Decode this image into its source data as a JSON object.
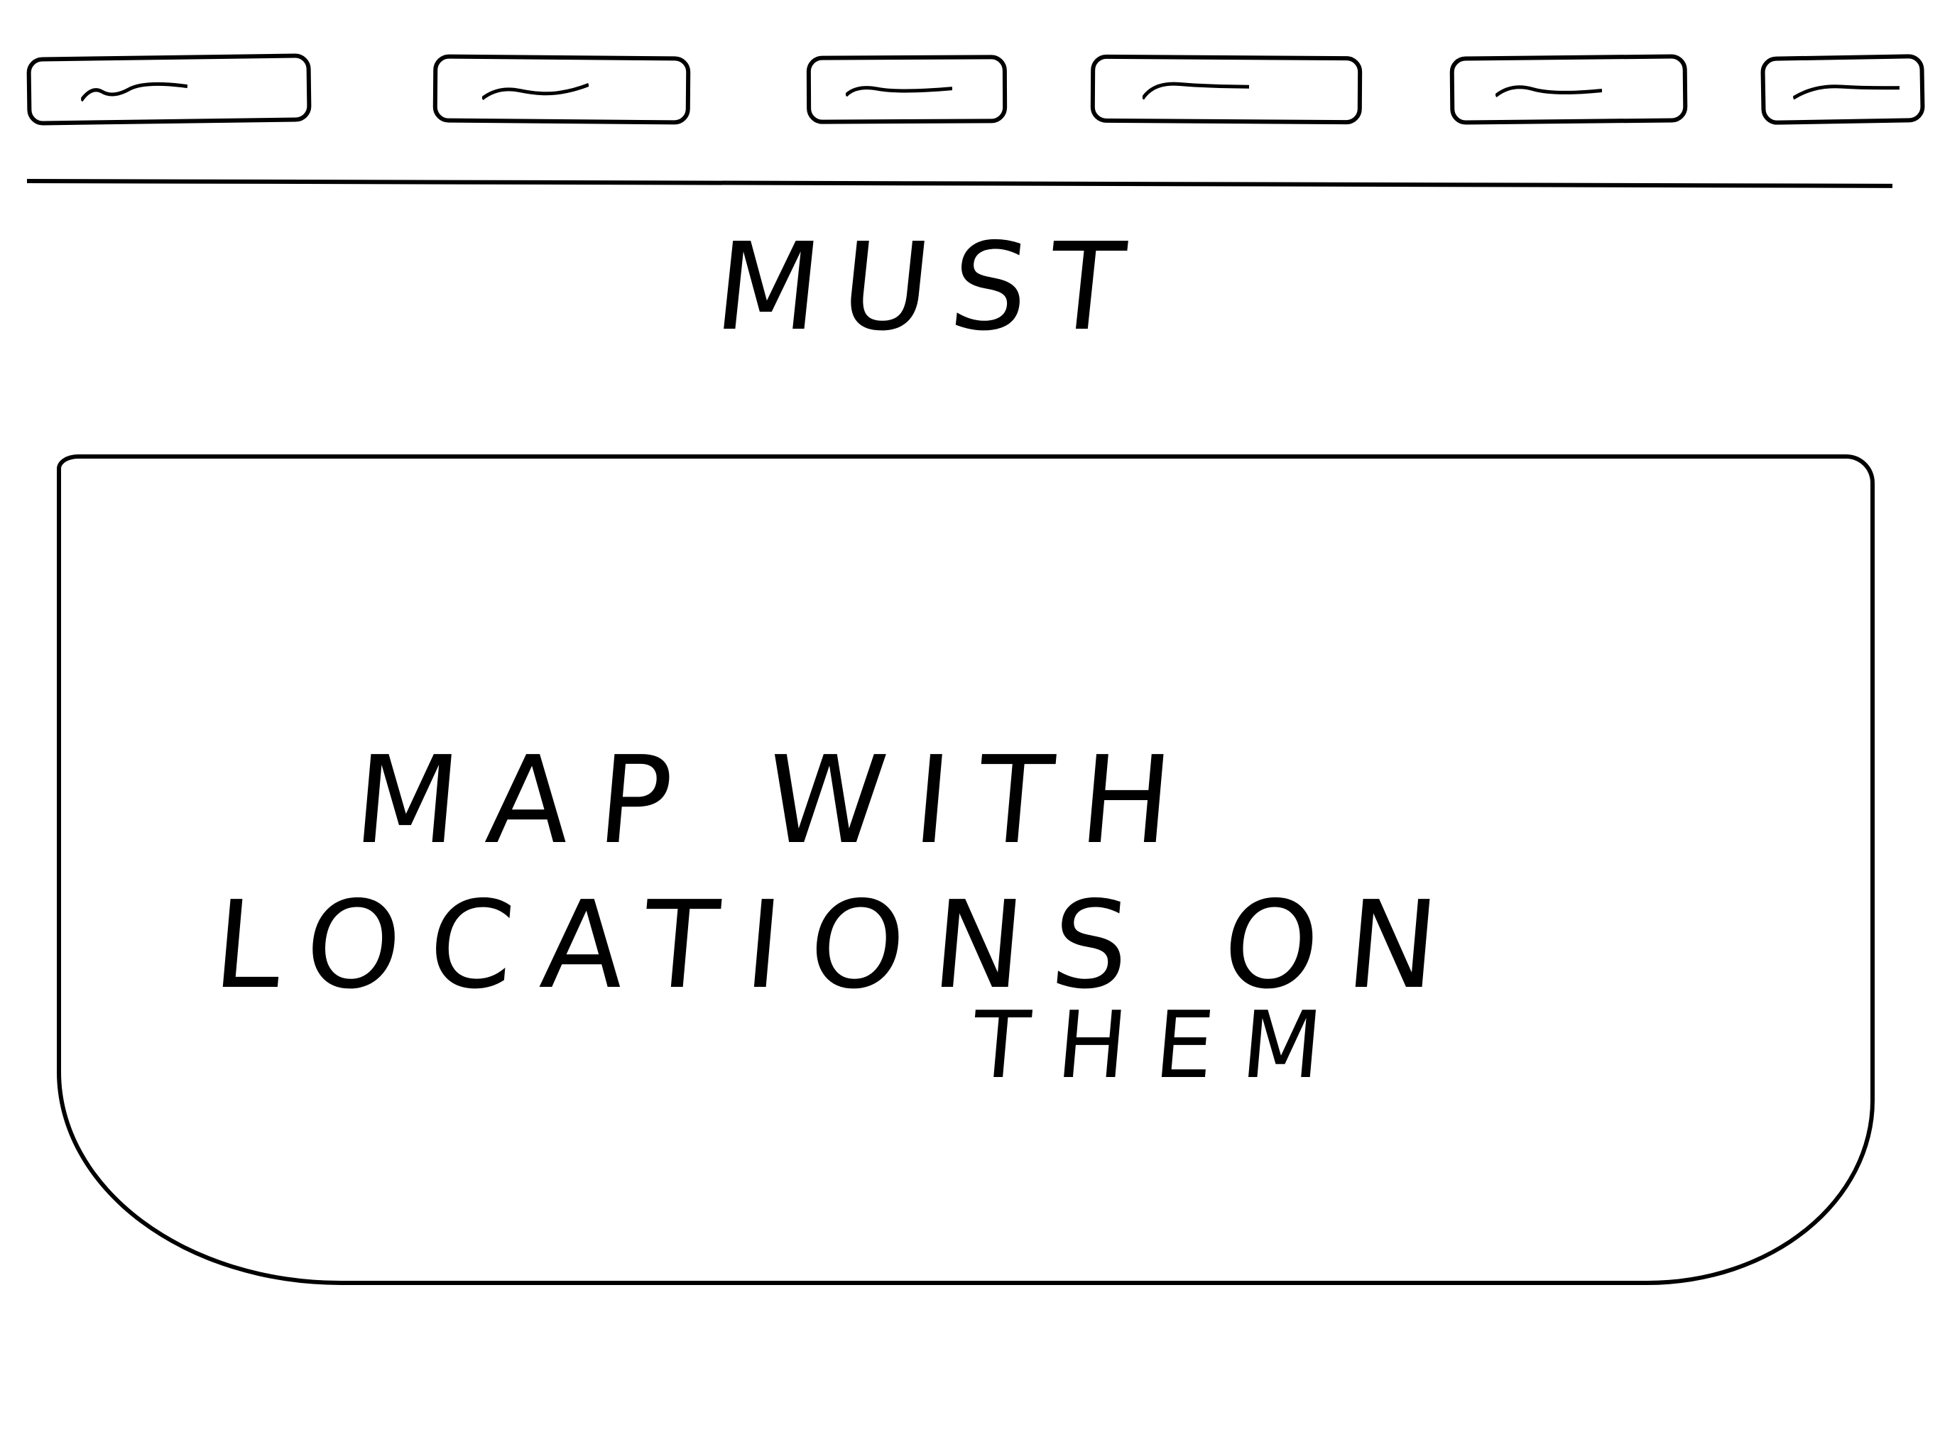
{
  "tabs": [
    {
      "label": ""
    },
    {
      "label": ""
    },
    {
      "label": ""
    },
    {
      "label": ""
    },
    {
      "label": ""
    },
    {
      "label": ""
    }
  ],
  "header": {
    "title": "MUST"
  },
  "map": {
    "label_line1": "MAP WITH",
    "label_line2": "LOCATIONS ON",
    "label_line3": "THEM"
  }
}
